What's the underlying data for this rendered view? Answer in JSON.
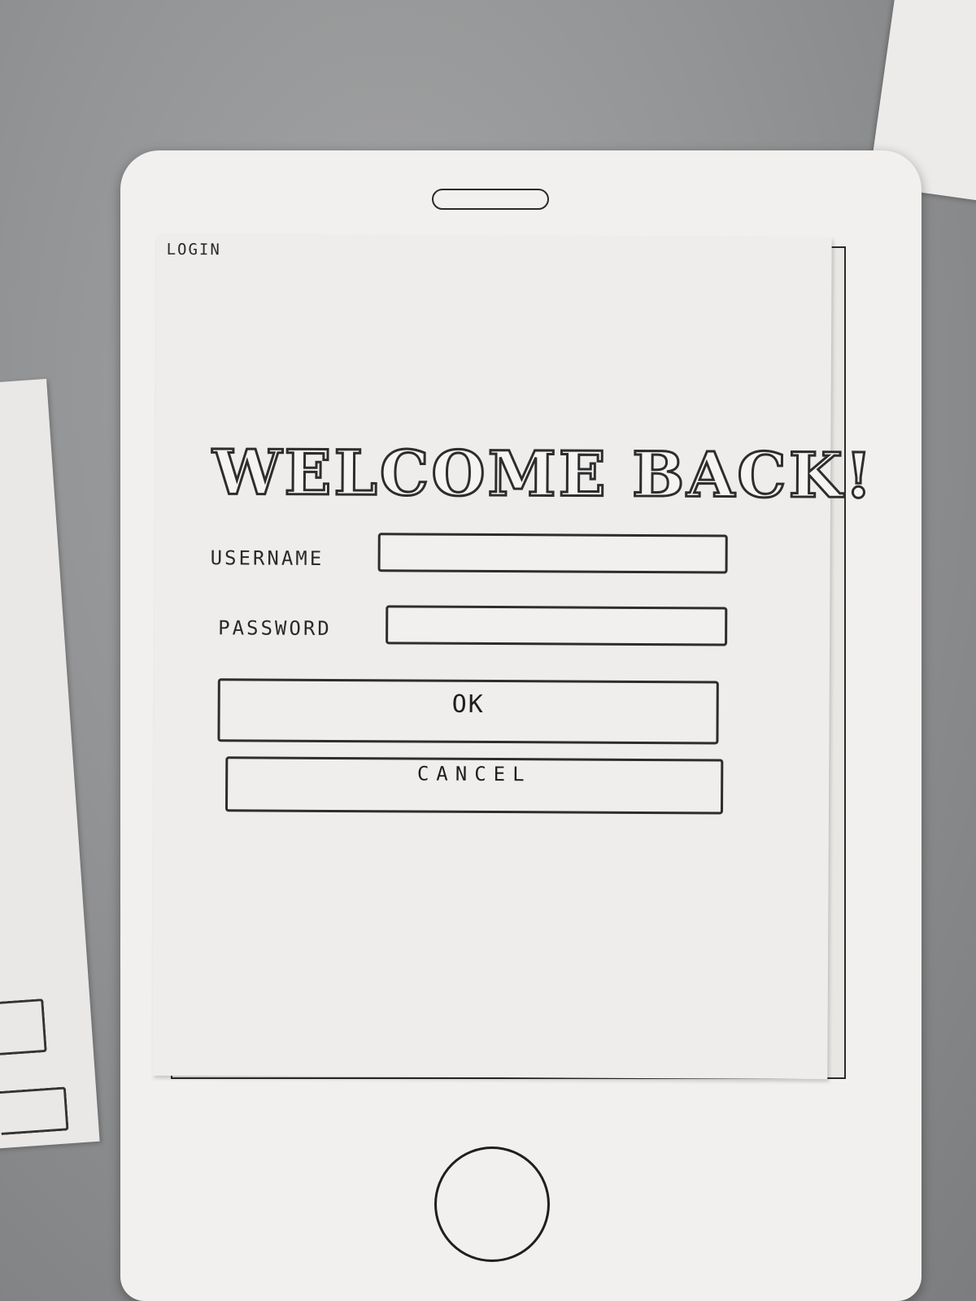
{
  "screen": {
    "header_label": "LOGIN",
    "title": "WELCOME BACK!"
  },
  "form": {
    "username_label": "USERNAME",
    "password_label": "PASSWORD",
    "username_value": "",
    "password_value": ""
  },
  "actions": {
    "ok_label": "OK",
    "cancel_label": "CANCEL"
  },
  "colors": {
    "paper": "#eeedeb",
    "ink": "#2d2d2d",
    "table": "#8e8f90"
  }
}
